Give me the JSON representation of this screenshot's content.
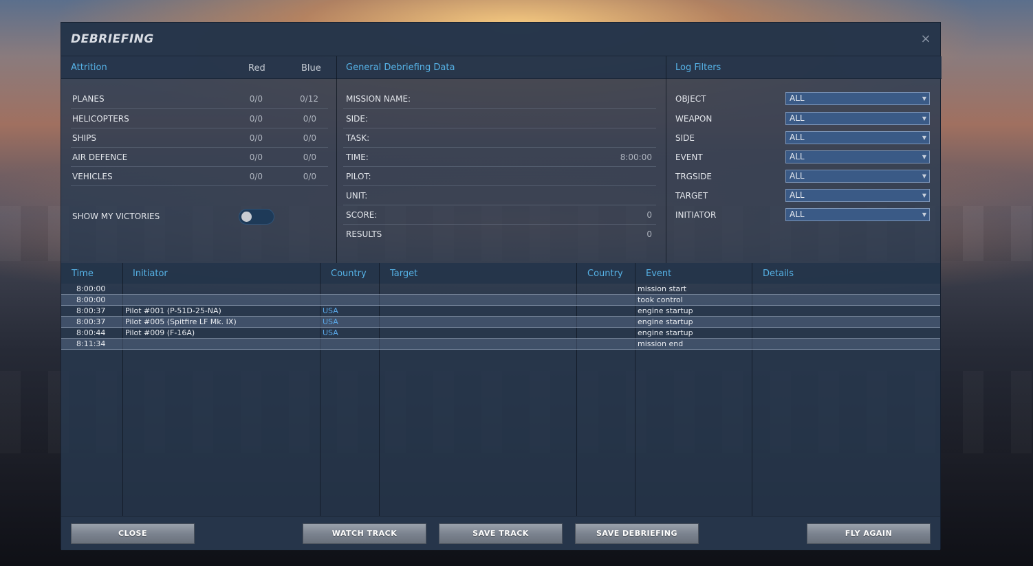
{
  "window": {
    "title": "DEBRIEFING",
    "close_icon": "×"
  },
  "attrition": {
    "heading": "Attrition",
    "col_red": "Red",
    "col_blue": "Blue",
    "rows": [
      {
        "label": "PLANES",
        "red": "0/0",
        "blue": "0/12"
      },
      {
        "label": "HELICOPTERS",
        "red": "0/0",
        "blue": "0/0"
      },
      {
        "label": "SHIPS",
        "red": "0/0",
        "blue": "0/0"
      },
      {
        "label": "AIR DEFENCE",
        "red": "0/0",
        "blue": "0/0"
      },
      {
        "label": "VEHICLES",
        "red": "0/0",
        "blue": "0/0"
      }
    ],
    "show_victories_label": "SHOW MY VICTORIES",
    "show_victories_on": false
  },
  "general": {
    "heading": "General Debriefing Data",
    "rows": [
      {
        "label": "MISSION NAME:",
        "value": ""
      },
      {
        "label": "SIDE:",
        "value": ""
      },
      {
        "label": "TASK:",
        "value": ""
      },
      {
        "label": "TIME:",
        "value": "8:00:00"
      },
      {
        "label": "PILOT:",
        "value": ""
      },
      {
        "label": "UNIT:",
        "value": ""
      },
      {
        "label": "SCORE:",
        "value": "0"
      },
      {
        "label": "RESULTS",
        "value": "0"
      }
    ]
  },
  "filters": {
    "heading": "Log Filters",
    "rows": [
      {
        "label": "OBJECT",
        "value": "ALL"
      },
      {
        "label": "WEAPON",
        "value": "ALL"
      },
      {
        "label": "SIDE",
        "value": "ALL"
      },
      {
        "label": "EVENT",
        "value": "ALL"
      },
      {
        "label": "TRGSIDE",
        "value": "ALL"
      },
      {
        "label": "TARGET",
        "value": "ALL"
      },
      {
        "label": "INITIATOR",
        "value": "ALL"
      }
    ]
  },
  "log": {
    "headers": {
      "time": "Time",
      "initiator": "Initiator",
      "country": "Country",
      "target": "Target",
      "target_country": "Country",
      "event": "Event",
      "details": "Details"
    },
    "rows": [
      {
        "time": "8:00:00",
        "initiator": "",
        "country": "",
        "target": "",
        "target_country": "",
        "event": "mission start",
        "details": ""
      },
      {
        "time": "8:00:00",
        "initiator": "",
        "country": "",
        "target": "",
        "target_country": "",
        "event": "took control",
        "details": ""
      },
      {
        "time": "8:00:37",
        "initiator": "Pilot #001 (P-51D-25-NA)",
        "country": "USA",
        "target": "",
        "target_country": "",
        "event": "engine startup",
        "details": ""
      },
      {
        "time": "8:00:37",
        "initiator": "Pilot #005 (Spitfire LF Mk. IX)",
        "country": "USA",
        "target": "",
        "target_country": "",
        "event": "engine startup",
        "details": ""
      },
      {
        "time": "8:00:44",
        "initiator": "Pilot #009 (F-16A)",
        "country": "USA",
        "target": "",
        "target_country": "",
        "event": "engine startup",
        "details": ""
      },
      {
        "time": "8:11:34",
        "initiator": "",
        "country": "",
        "target": "",
        "target_country": "",
        "event": "mission end",
        "details": ""
      }
    ]
  },
  "footer": {
    "close": "CLOSE",
    "watch_track": "WATCH TRACK",
    "save_track": "SAVE TRACK",
    "save_debriefing": "SAVE DEBRIEFING",
    "fly_again": "FLY AGAIN"
  },
  "colors": {
    "accent": "#56b2e6",
    "country_link": "#5aa8e8",
    "select_bg": "#3a5a86"
  }
}
